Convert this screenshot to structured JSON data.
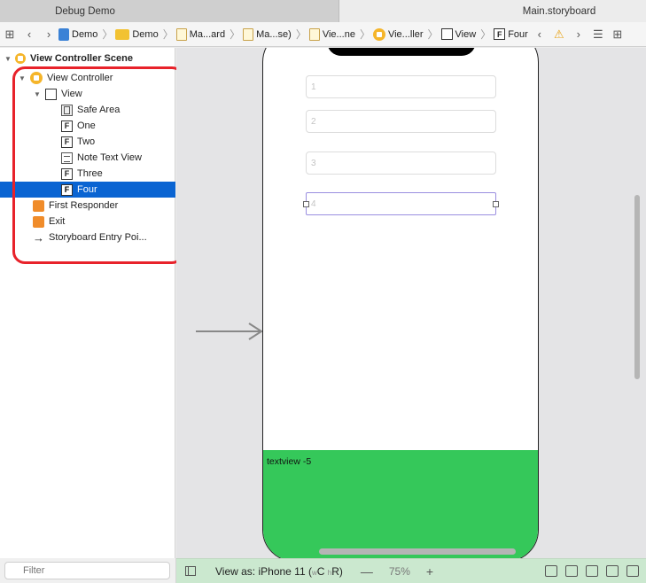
{
  "tabs": [
    {
      "label": "Debug Demo",
      "active": false
    },
    {
      "label": "Main.storyboard",
      "active": true
    }
  ],
  "jumpbar": {
    "crumbs": [
      "Demo",
      "Demo",
      "Ma...ard",
      "Ma...se)",
      "Vie...ne",
      "Vie...ller",
      "View",
      "Four"
    ]
  },
  "outline": {
    "scene": "View Controller Scene",
    "view_controller": "View Controller",
    "view": "View",
    "items": [
      "Safe Area",
      "One",
      "Two",
      "Note Text View",
      "Three",
      "Four"
    ],
    "first_responder": "First Responder",
    "exit": "Exit",
    "entry_point": "Storyboard Entry Poi..."
  },
  "canvas": {
    "fields": [
      "1",
      "2",
      "3",
      "4"
    ],
    "textview_label": "textview -5",
    "colors": {
      "textview_bg": "#35c85a",
      "selection": "#0a64d2",
      "highlight_ring": "#e8222a"
    }
  },
  "filter": {
    "placeholder": "Filter"
  },
  "bottombar": {
    "view_as": "View as: iPhone 11 (",
    "w": "w",
    "c": "C ",
    "h": "h",
    "r": "R)",
    "minus": "—",
    "zoom": "75%",
    "plus": "+"
  }
}
